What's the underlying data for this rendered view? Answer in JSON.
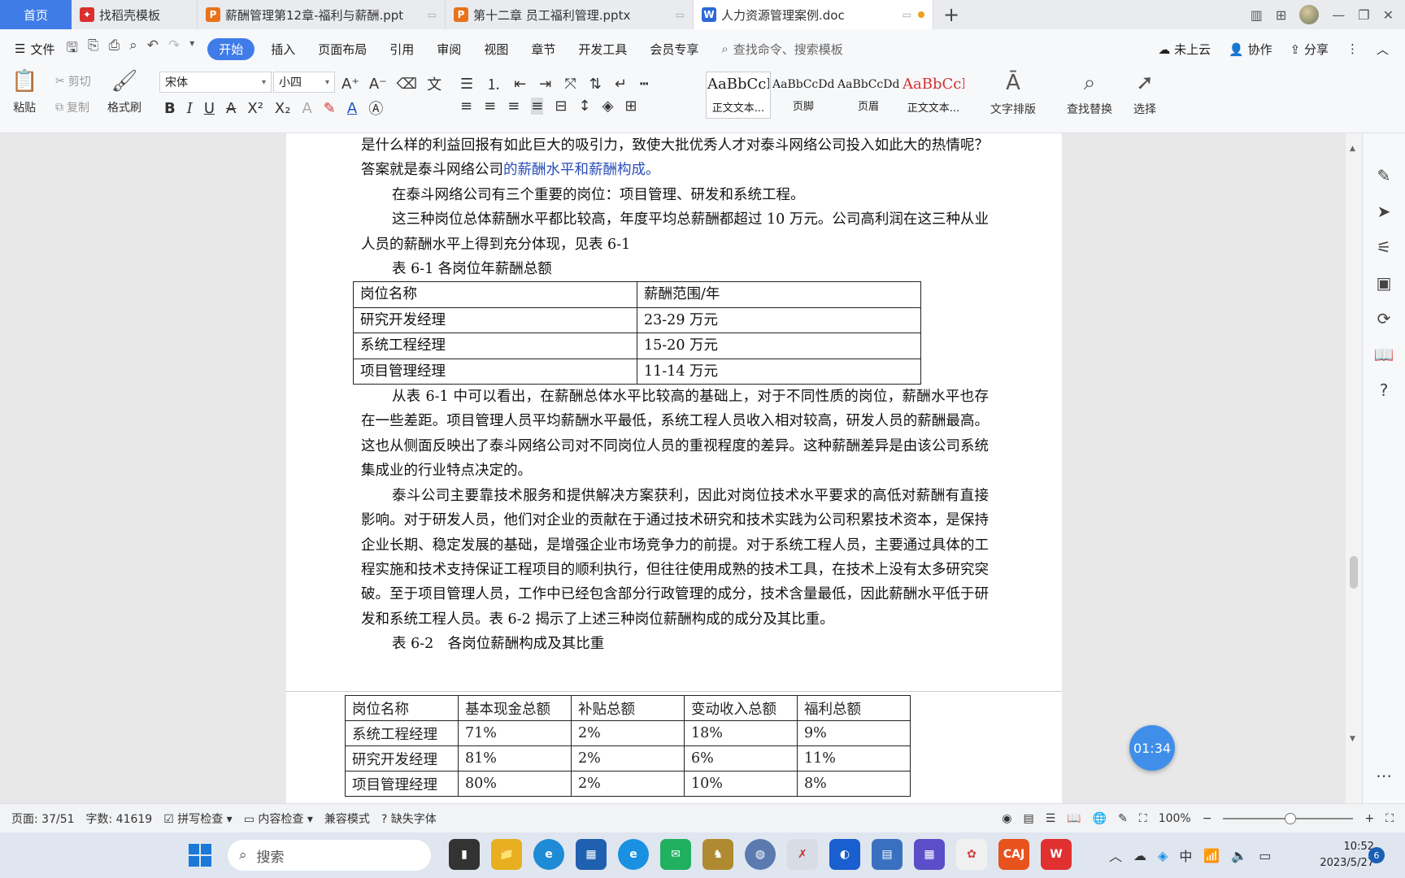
{
  "tabs": {
    "home": "首页",
    "items": [
      {
        "icon_text": "W",
        "icon_color": "#d8302f",
        "label": "找稻壳模板",
        "monitor": ""
      },
      {
        "icon_text": "P",
        "icon_color": "#e8731c",
        "label": "薪酬管理第12章-福利与薪酬.ppt",
        "monitor": "▭"
      },
      {
        "icon_text": "P",
        "icon_color": "#e8731c",
        "label": "第十二章 员工福利管理.pptx",
        "monitor": "▭"
      },
      {
        "icon_text": "W",
        "icon_color": "#2b6ad6",
        "label": "人力资源管理案例.doc",
        "monitor": "▭"
      }
    ],
    "add": "+"
  },
  "menu": {
    "file": "文件",
    "items": [
      "开始",
      "插入",
      "页面布局",
      "引用",
      "审阅",
      "视图",
      "章节",
      "开发工具",
      "会员专享"
    ],
    "active": "开始",
    "search": "查找命令、搜索模板",
    "right": [
      "未上云",
      "协作",
      "分享"
    ]
  },
  "ribbon": {
    "paste": "粘贴",
    "cut": "剪切",
    "copy": "复制",
    "format_painter": "格式刷",
    "font_name": "宋体",
    "font_size": "小四",
    "styles": [
      {
        "sample": "AaBbCcI",
        "label": "正文文本...",
        "color": "#111"
      },
      {
        "sample": "AaBbCcDd",
        "label": "页脚",
        "color": "#111"
      },
      {
        "sample": "AaBbCcDd",
        "label": "页眉",
        "color": "#111"
      },
      {
        "sample": "AaBbCcI",
        "label": "正文文本...",
        "color": "#d23030"
      }
    ],
    "text_layout": "文字排版",
    "find_replace": "查找替换",
    "select": "选择"
  },
  "document": {
    "p1_a": "是什么样的利益回报有如此巨大的吸引力，致使大批优秀人才对泰斗网络公司投入如此大的热情呢？答案就是泰斗网络公司",
    "p1_link": "的薪酬水平和薪酬构成。",
    "p2": "在泰斗网络公司有三个重要的岗位：项目管理、研发和系统工程。",
    "p3": "这三种岗位总体薪酬水平都比较高，年度平均总薪酬都超过 10 万元。公司高利润在这三种从业人员的薪酬水平上得到充分体现，见表 6-1",
    "caption1": "表 6-1 各岗位年薪酬总额",
    "table1": {
      "headers": [
        "岗位名称",
        "薪酬范围/年"
      ],
      "rows": [
        [
          "研究开发经理",
          "23-29 万元"
        ],
        [
          "系统工程经理",
          "15-20 万元"
        ],
        [
          "项目管理经理",
          "11-14 万元"
        ]
      ]
    },
    "p4": "从表 6-1 中可以看出，在薪酬总体水平比较高的基础上，对于不同性质的岗位，薪酬水平也存在一些差距。项目管理人员平均薪酬水平最低，系统工程人员收入相对较高，研发人员的薪酬最高。这也从侧面反映出了泰斗网络公司对不同岗位人员的重视程度的差异。这种薪酬差异是由该公司系统集成业的行业特点决定的。",
    "p5": "泰斗公司主要靠技术服务和提供解决方案获利，因此对岗位技术水平要求的高低对薪酬有直接影响。对于研发人员，他们对企业的贡献在于通过技术研究和技术实践为公司积累技术资本，是保持企业长期、稳定发展的基础，是增强企业市场竞争力的前提。对于系统工程人员，主要通过具体的工程实施和技术支持保证工程项目的顺利执行，但往往使用成熟的技术工具，在技术上没有太多研究突破。至于项目管理人员，工作中已经包含部分行政管理的成分，技术含量最低，因此薪酬水平低于研发和系统工程人员。表 6-2 揭示了上述三种岗位薪酬构成的成分及其比重。",
    "caption2": "表 6-2　各岗位薪酬构成及其比重",
    "table2": {
      "headers": [
        "岗位名称",
        "基本现金总额",
        "补贴总额",
        "变动收入总额",
        "福利总额"
      ],
      "rows": [
        [
          "系统工程经理",
          "71%",
          "2%",
          "18%",
          "9%"
        ],
        [
          "研究开发经理",
          "81%",
          "2%",
          "6%",
          "11%"
        ],
        [
          "项目管理经理",
          "80%",
          "2%",
          "10%",
          "8%"
        ]
      ]
    }
  },
  "timer": "01:34",
  "status": {
    "page": "页面: 37/51",
    "words": "字数: 41619",
    "spell": "拼写检查",
    "content": "内容检查",
    "compat": "兼容模式",
    "missing_font": "缺失字体",
    "zoom": "100%"
  },
  "taskbar": {
    "search": "搜索",
    "ime": "中",
    "time": "10:52",
    "date": "2023/5/27",
    "badge": "6"
  }
}
